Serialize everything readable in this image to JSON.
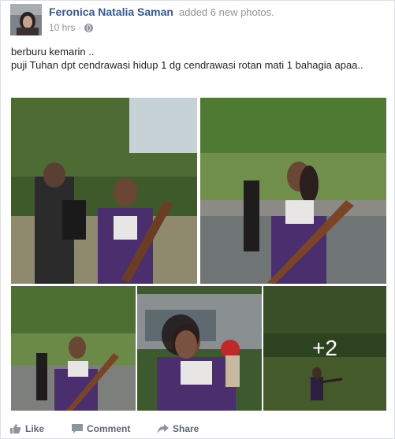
{
  "post": {
    "author_name": "Feronica Natalia Saman",
    "action_text": "added 6 new photos.",
    "timestamp": "10 hrs",
    "separator": "·",
    "privacy_icon": "globe-icon",
    "text_lines": [
      "berburu kemarin ..",
      "puji Tuhan dpt cendrawasi hidup 1 dg cendrawasi rotan mati 1 bahagia apaa.."
    ]
  },
  "photos": {
    "more_count_label": "+2"
  },
  "actions": {
    "like_label": "Like",
    "comment_label": "Comment",
    "share_label": "Share",
    "color": "#606770"
  },
  "colors": {
    "author_link": "#365899",
    "meta_gray": "#90949c"
  }
}
